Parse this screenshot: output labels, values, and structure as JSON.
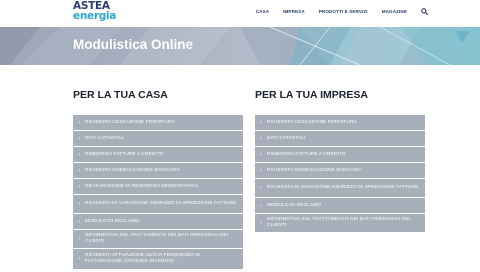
{
  "brand": {
    "line1": "ASTEA",
    "line2": "energia"
  },
  "nav": {
    "items": [
      "CASA",
      "IMPRESA",
      "PRODOTTI E SERVIZI",
      "MAGAZINE"
    ],
    "search_icon": "search-icon"
  },
  "hero": {
    "title": "Modulistica Online"
  },
  "sections": {
    "casa": {
      "heading": "PER LA TUA CASA",
      "items": [
        "RICHIESTA CESSAZIONE FORNITURA",
        "DATI CATASTALI",
        "RIMBORSO FATTURE A CREDITO",
        "RICHIESTA DOMICILIAZIONE BANCARIA",
        "DICHIARAZIONE DI RESIDENZA DEMOGRAFICA",
        "RICHIESTA DI VARIAZIONE INDIRIZZO DI SPEDIZIONE FATTURE",
        "MODULO DI RECLAMO",
        "INFORMATIVA SUL TRATTAMENTO DEI DATI PERSONALI DEI CLIENTI",
        "RICHIESTA ATTIVAZIONE NUOVA FREQUENZA DI FATTURAZIONE (OPZIONE INVERNO)"
      ]
    },
    "impresa": {
      "heading": "PER LA TUA IMPRESA",
      "items": [
        "RICHIESTA CESSAZIONE FORNITURA",
        "DATI CATASTALI",
        "RIMBORSO FATTURE A CREDITO",
        "RICHIESTA DOMICILIAZIONE BANCARIA",
        "RICHIESTA DI VARIAZIONE INDIRIZZO DI SPEDIZIONE FATTURE",
        "MODULO DI RECLAMO",
        "INFORMATIVA SUL TRATTAMENTO DEI DATI PERSONALI DEI CLIENTI"
      ]
    }
  },
  "item_icon": "chevron-right-icon",
  "colors": {
    "brand_navy": "#2b3b6e",
    "brand_cyan": "#2aa7c9",
    "row_bg": "#a6afba"
  }
}
